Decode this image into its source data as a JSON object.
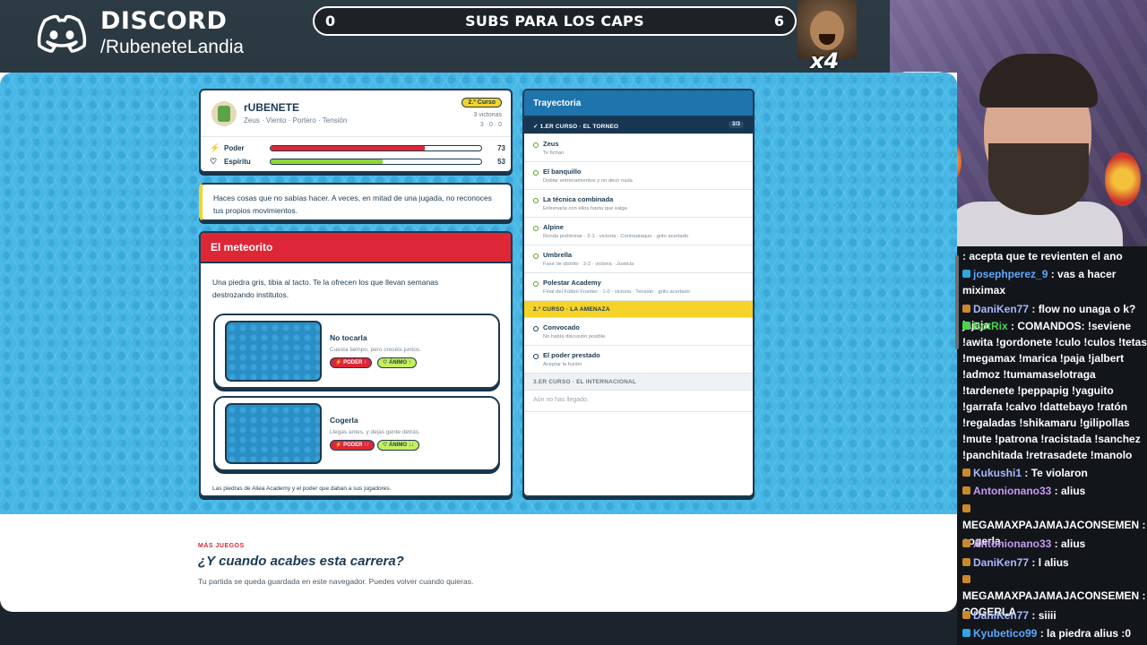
{
  "overlay": {
    "discord_title": "DISCORD",
    "discord_handle": "/RubeneteLandia",
    "subs_left": "0",
    "subs_label": "SUBS PARA LOS CAPS",
    "subs_right": "6",
    "multiplier": "x4"
  },
  "profile": {
    "name": "rUBENETE",
    "subtitle": "Zeus · Viento · Portero · Tensión",
    "badge": "2.º Curso",
    "wins": "3 victorias",
    "stats_line": "3 · 0 · 0",
    "stats": [
      {
        "label": "Poder",
        "value": "73",
        "fill": 0.73,
        "color": "#dd2737",
        "icon": "bolt-icon",
        "glyph": "⚡"
      },
      {
        "label": "Espíritu",
        "value": "53",
        "fill": 0.53,
        "color": "#8fd63a",
        "icon": "heart-icon",
        "glyph": "♡"
      }
    ]
  },
  "quote": "Haces cosas que no sabías hacer. A veces, en mitad de una jugada, no reconoces tus propios movimientos.",
  "event": {
    "title": "El meteorito",
    "description": "Una piedra gris, tibia al tacto. Te la ofrecen los que llevan semanas destrozando institutos.",
    "choices": [
      {
        "title": "No tocarla",
        "subtitle": "Cuesta tiempo, pero crecéis juntos.",
        "tag_red": "⚡ PODER ↑",
        "tag_green": "♡ ÁNIMO ↑"
      },
      {
        "title": "Cogerla",
        "subtitle": "Llegas antes, y dejas gente detrás.",
        "tag_red": "⚡ PODER ↑↑",
        "tag_green": "♡ ÁNIMO ↓↓"
      }
    ],
    "footer": "Las piedras de Aliea Academy y el poder que daban a sus jugadores."
  },
  "trajectory": {
    "title": "Trayectoria",
    "sections": [
      {
        "label": "1.ER CURSO · EL TORNEO",
        "count": "3/3",
        "style": "dark"
      },
      {
        "label": "2.º CURSO · LA AMENAZA",
        "style": "yellow"
      },
      {
        "label": "3.ER CURSO · EL INTERNACIONAL",
        "style": "grey"
      }
    ],
    "items": [
      {
        "title": "Zeus",
        "sub": "Te fichan"
      },
      {
        "title": "El banquillo",
        "sub": "Doblar entrenamientos y no decir nada"
      },
      {
        "title": "La técnica combinada",
        "sub": "Entrenarla con ellos hasta que salga"
      },
      {
        "title": "Alpine",
        "sub": "Ronda preliminar · 2-1 · victoria · Contraataque · grito acertado"
      },
      {
        "title": "Umbrella",
        "sub": "Fase de distrito · 3-2 · victoria · Justicia"
      },
      {
        "title": "Polestar Academy",
        "sub": "Final del Fútbol Frontier · 1-0 · victoria · Tensión · grito acertado"
      },
      {
        "title": "Convocado",
        "sub": "No había discusión posible."
      },
      {
        "title": "El poder prestado",
        "sub": "Aceptar la fusión"
      }
    ],
    "empty": "Aún no has llegado."
  },
  "more": {
    "kicker": "MÁS JUEGOS",
    "title": "¿Y cuando acabes esta carrera?",
    "text": "Tu partida se queda guardada en este navegador. Puedes volver cuando quieras."
  },
  "chat": [
    {
      "user": "",
      "text": ": acepta que te revienten el ano",
      "color": "#ffffff"
    },
    {
      "user": "josephperez_9",
      "text": ": vas a hacer miximax",
      "color": "#5fa8ff"
    },
    {
      "user": "DaniKen77",
      "text": ": flow no unaga o k? jajaja",
      "color": "#a8b8ff"
    },
    {
      "user": "BotRix",
      "text": ": COMANDOS: !seviene !awita !gordonete !culo !culos !tetas !megamax !marica !paja !jalbert !admoz !tumamaselotraga !tardenete !peppapig !yaguito !garrafa !calvo !dattebayo !ratón !regaladas !shikamaru !gilipollas !mute !patrona !racistada !sanchez !panchitada !retrasadete !manolo",
      "color": "#4fd14f"
    },
    {
      "user": "Kukushi1",
      "text": ": Te violaron",
      "color": "#a8b8ff"
    },
    {
      "user": "Antonionano33",
      "text": ": alius",
      "color": "#c89af0"
    },
    {
      "user": "MEGAMAXPAJAMAJACONSEMEN",
      "text": ": cogerla",
      "color": "#ffffff"
    },
    {
      "user": "Antonionano33",
      "text": ": alius",
      "color": "#c89af0"
    },
    {
      "user": "DaniKen77",
      "text": ": l alius",
      "color": "#a8b8ff"
    },
    {
      "user": "MEGAMAXPAJAMAJACONSEMEN",
      "text": ": COGERLA",
      "color": "#ffffff"
    },
    {
      "user": "DaniKen77",
      "text": ": siiii",
      "color": "#a8b8ff"
    },
    {
      "user": "Kyubetico99",
      "text": ": la piedra alius :0",
      "color": "#5fa8ff"
    }
  ]
}
